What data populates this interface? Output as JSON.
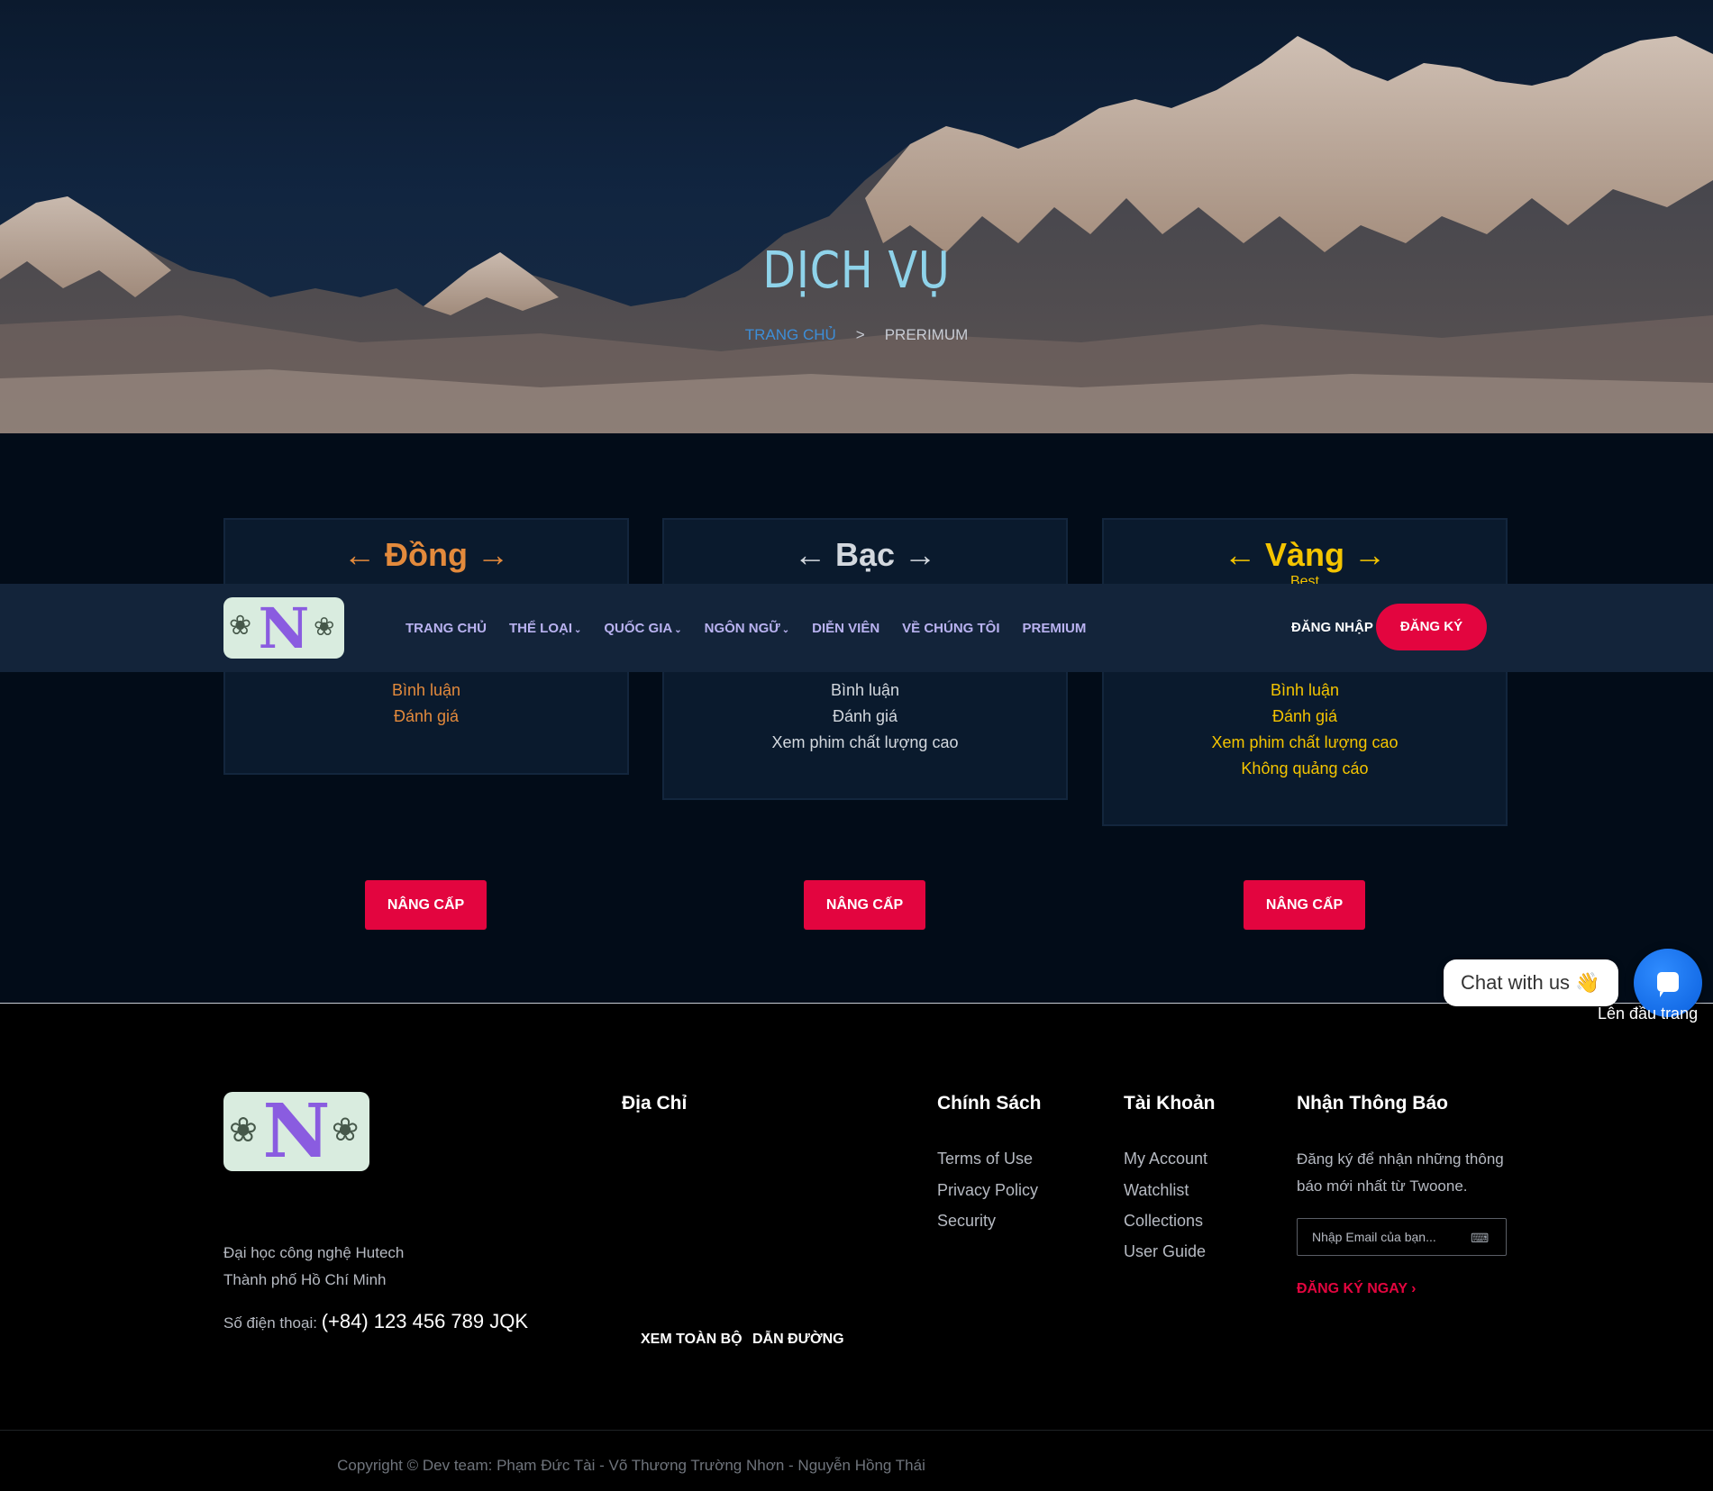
{
  "hero": {
    "title": "DỊCH VỤ",
    "breadcrumb_home": "TRANG CHỦ",
    "breadcrumb_sep": ">",
    "breadcrumb_current": "PRERIMUM"
  },
  "plans": [
    {
      "left_arrow": "←",
      "name": "Đồng",
      "right_arrow": "→",
      "features": [
        "Bình luận",
        "Đánh giá"
      ],
      "button": "NÂNG CẤP",
      "color": "#e38a3c"
    },
    {
      "left_arrow": "←",
      "name": "Bạc",
      "right_arrow": "→",
      "features": [
        "Bình luận",
        "Đánh giá",
        "Xem phim chất lượng cao"
      ],
      "button": "NÂNG CẤP",
      "color": "#d3d8de"
    },
    {
      "left_arrow": "←",
      "name": "Vàng",
      "right_arrow": "→",
      "badge": "Best",
      "features": [
        "Bình luận",
        "Đánh giá",
        "Xem phim chất lượng cao",
        "Không quảng cáo"
      ],
      "button": "NÂNG CẤP",
      "color": "#f4c400"
    }
  ],
  "navbar": {
    "logo_letter": "N",
    "links": [
      {
        "label": "TRANG CHỦ",
        "dropdown": false
      },
      {
        "label": "THỂ LOẠI",
        "dropdown": true
      },
      {
        "label": "QUỐC GIA",
        "dropdown": true
      },
      {
        "label": "NGÔN NGỮ",
        "dropdown": true
      },
      {
        "label": "DIỄN VIÊN",
        "dropdown": false
      },
      {
        "label": "VỀ CHÚNG TÔI",
        "dropdown": false
      },
      {
        "label": "PREMIUM",
        "dropdown": false
      }
    ],
    "login": "ĐĂNG NHẬP",
    "signup": "ĐĂNG KÝ"
  },
  "chat": {
    "bubble": "Chat with us 👋",
    "to_top": "Lên đầu trang"
  },
  "footer": {
    "logo_letter": "N",
    "address_line1": "Đại học công nghệ Hutech",
    "address_line2": "Thành phố Hồ Chí Minh",
    "phone_label": "Số điện thoại:",
    "phone_number": "(+84) 123 456 789 JQK",
    "address_heading": "Địa Chỉ",
    "view_all": "XEM TOÀN BỘ",
    "directions": "DẪN ĐƯỜNG",
    "policy_heading": "Chính Sách",
    "policy_links": [
      "Terms of Use",
      "Privacy Policy",
      "Security"
    ],
    "account_heading": "Tài Khoản",
    "account_links": [
      "My Account",
      "Watchlist",
      "Collections",
      "User Guide"
    ],
    "newsletter_heading": "Nhận Thông Báo",
    "newsletter_text1": "Đăng ký để nhận những thông",
    "newsletter_text2": "báo mới nhất từ Twoone.",
    "email_placeholder": "Nhập Email của bạn...",
    "subscribe": "ĐĂNG KÝ NGAY",
    "copyright": "Copyright © Dev team: Phạm Đức Tài - Võ Thương Trường Nhơn - Nguyễn Hồng Thái"
  }
}
